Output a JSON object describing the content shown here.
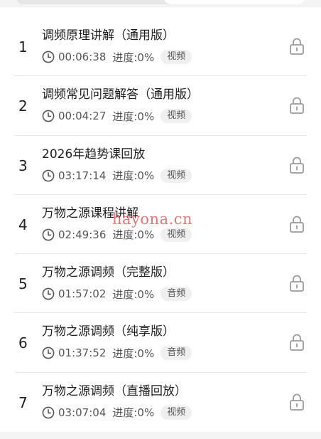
{
  "lessons": [
    {
      "index": "1",
      "title": "调频原理讲解（通用版）",
      "duration": "00:06:38",
      "progress": "进度:0%",
      "type": "视频"
    },
    {
      "index": "2",
      "title": "调频常见问题解答（通用版）",
      "duration": "00:04:27",
      "progress": "进度:0%",
      "type": "视频"
    },
    {
      "index": "3",
      "title": "2026年趋势课回放",
      "duration": "03:17:14",
      "progress": "进度:0%",
      "type": "视频"
    },
    {
      "index": "4",
      "title": "万物之源课程讲解",
      "duration": "02:49:36",
      "progress": "进度:0%",
      "type": "视频"
    },
    {
      "index": "5",
      "title": "万物之源调频（完整版）",
      "duration": "01:57:02",
      "progress": "进度:0%",
      "type": "音频"
    },
    {
      "index": "6",
      "title": "万物之源调频（纯享版）",
      "duration": "01:37:52",
      "progress": "进度:0%",
      "type": "音频"
    },
    {
      "index": "7",
      "title": "万物之源调频（直播回放）",
      "duration": "03:07:04",
      "progress": "进度:0%",
      "type": "视频"
    }
  ],
  "watermark": "hayona.cn",
  "icons": {
    "duration": "clock-icon",
    "status": "lock-icon"
  },
  "colors": {
    "watermark": "#e14646",
    "tag_bg": "#f0f0f0",
    "divider": "#e8e8e8"
  }
}
